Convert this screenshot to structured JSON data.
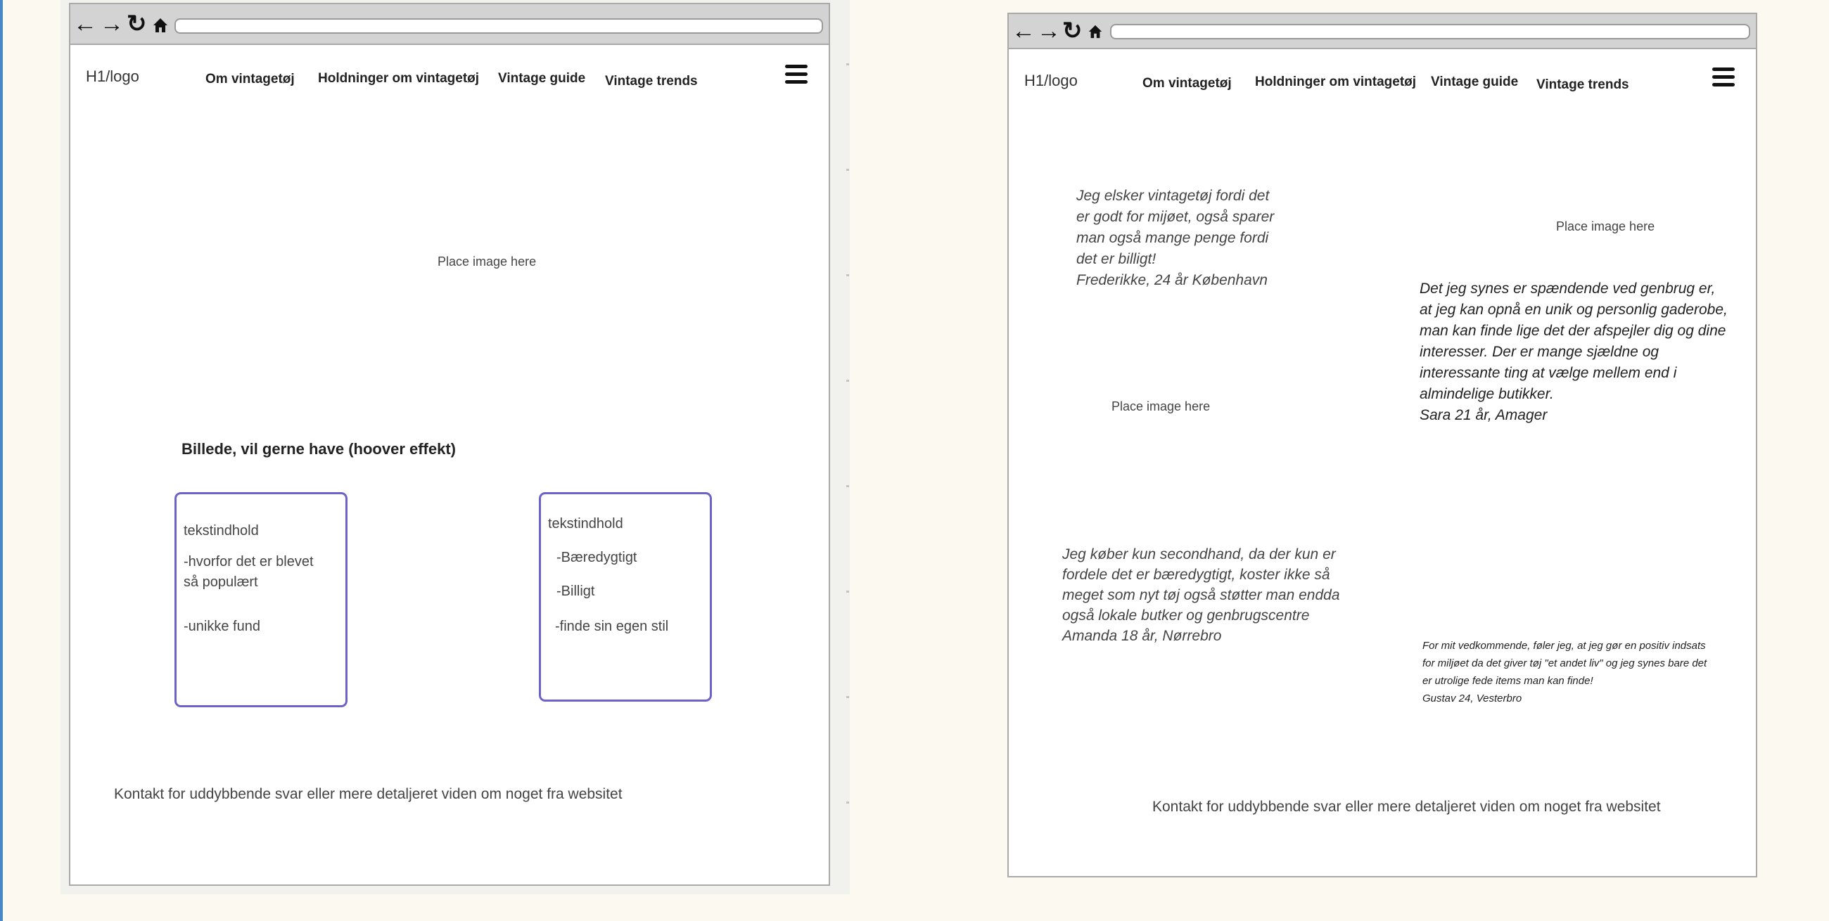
{
  "left_mockup": {
    "header": {
      "logo": "H1/logo",
      "nav": [
        "Om vintagetøj",
        "Holdninger om vintagetøj",
        "Vintage guide",
        "Vintage trends"
      ]
    },
    "hero_placeholder": "Place image here",
    "section_heading": "Billede, vil gerne have (hoover effekt)",
    "card_1": {
      "title": "tekstindhold",
      "line_1": "-hvorfor det er blevet",
      "line_2": "så populært",
      "line_3": "-unikke fund"
    },
    "card_2": {
      "title": "tekstindhold",
      "line_1": "-Bæredygtigt",
      "line_2": "-Billigt",
      "line_3": "-finde sin egen stil"
    },
    "footer": "Kontakt for uddybbende svar eller mere detaljeret viden om noget fra websitet"
  },
  "right_mockup": {
    "header": {
      "logo": "H1/logo",
      "nav": [
        "Om vintagetøj",
        "Holdninger om vintagetøj",
        "Vintage guide",
        "Vintage trends"
      ]
    },
    "placeholder_1": "Place image here",
    "placeholder_2": "Place image here",
    "quote_1": [
      "Jeg elsker vintagetøj fordi det",
      "er godt for mijøet, også sparer",
      "man også mange penge fordi",
      "det er billigt!",
      "Frederikke, 24 år København"
    ],
    "quote_2": [
      "Det jeg synes er spændende ved genbrug er,",
      "at jeg kan opnå en unik og personlig gaderobe,",
      "man kan finde lige det der afspejler dig og dine",
      "interesser. Der er mange sjældne og",
      "interessante ting at vælge mellem end i",
      "almindelige butikker.",
      "Sara 21 år, Amager"
    ],
    "quote_3": [
      "Jeg køber kun secondhand, da der kun er",
      "fordele det er bæredygtigt, koster ikke så",
      "meget som nyt tøj også støtter man endda",
      "også lokale butker og genbrugscentre",
      "Amanda 18 år, Nørrebro"
    ],
    "quote_4": [
      "For mit vedkommende, føler jeg, at jeg gør en positiv indsats",
      "for miljøet da det giver tøj \"et andet liv\" og jeg synes bare det",
      "er utrolige fede items man kan finde!",
      "Gustav 24, Vesterbro"
    ],
    "footer": "Kontakt for uddybbende svar eller mere detaljeret viden om noget fra websitet"
  },
  "icons": {
    "back": "back-arrow-icon",
    "forward": "forward-arrow-icon",
    "reload": "reload-icon",
    "home": "home-icon",
    "menu": "hamburger-menu-icon"
  },
  "colors": {
    "card_border": "#6b63c9",
    "page_background": "#fcfaf0",
    "browser_bar": "#d3d3d3"
  }
}
